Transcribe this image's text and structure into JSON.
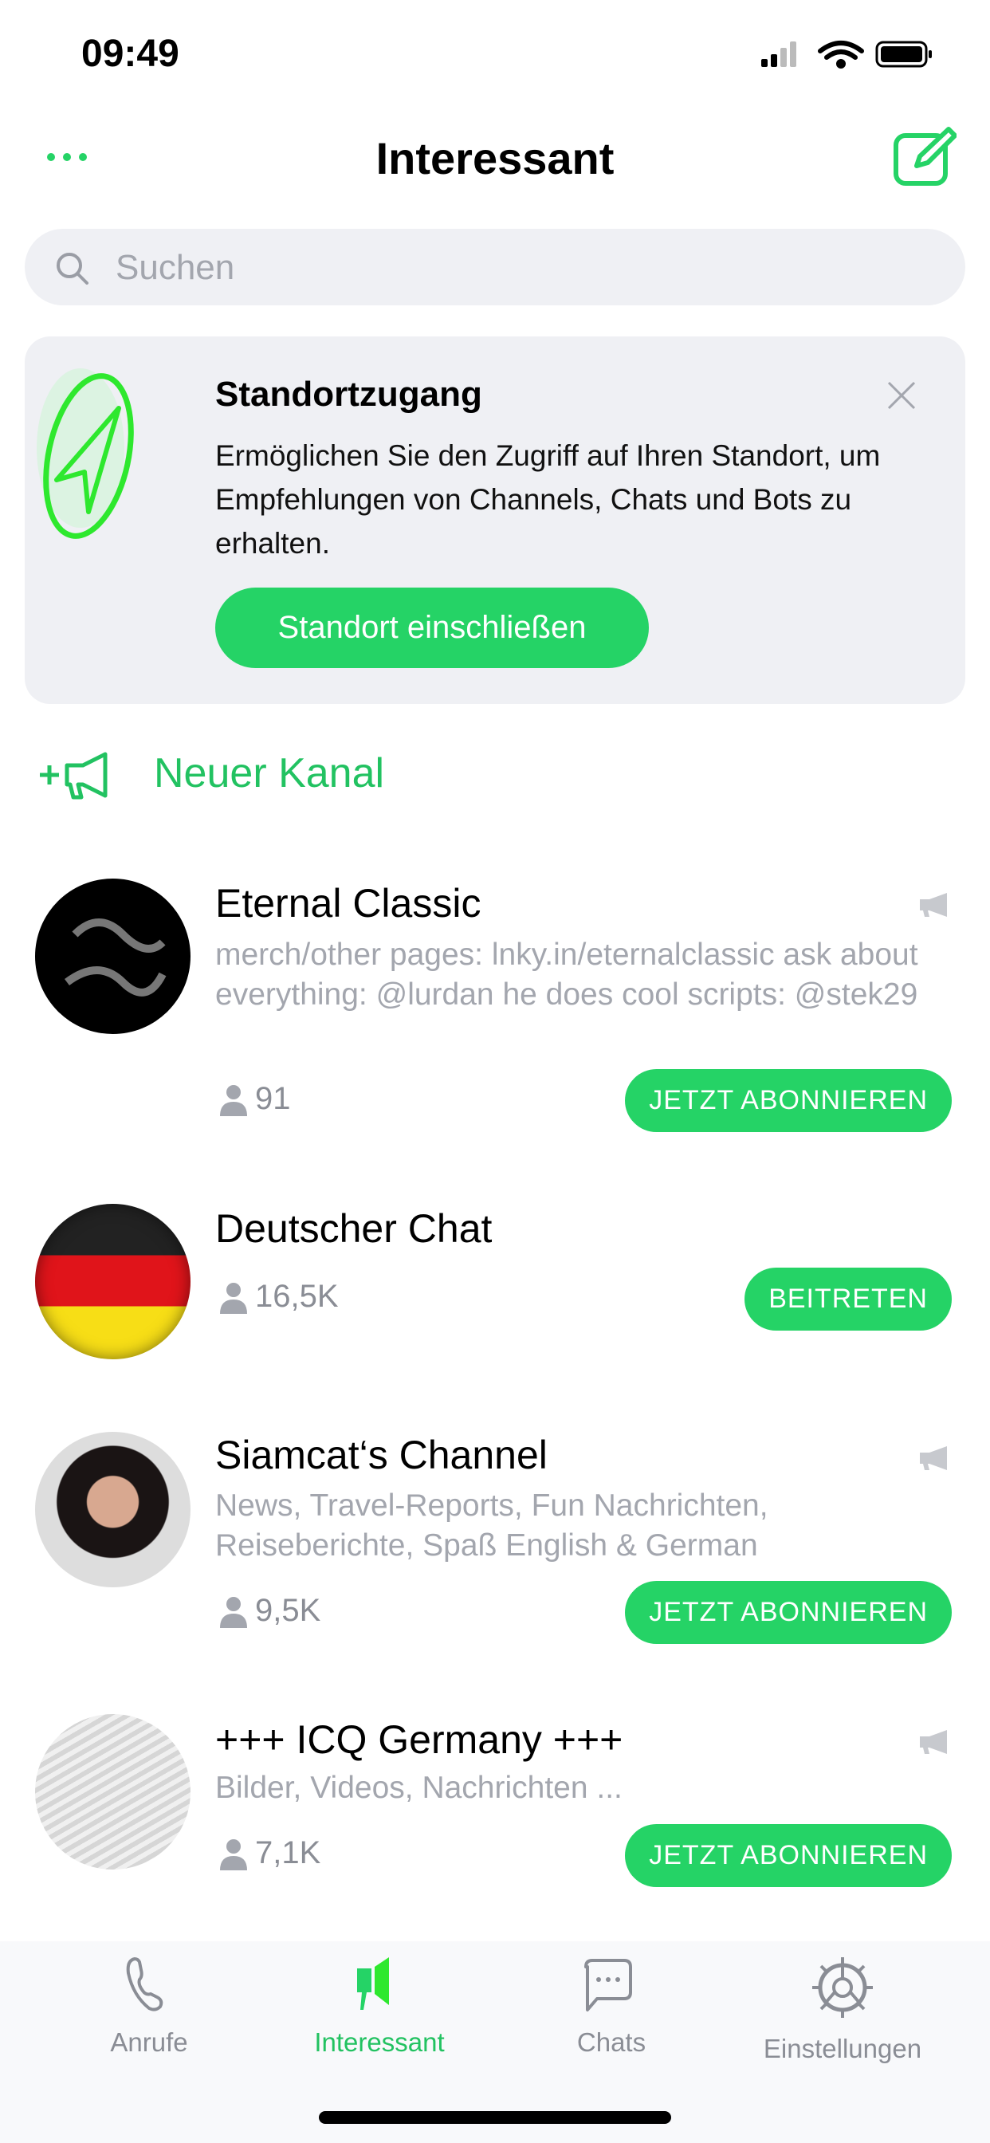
{
  "status_bar": {
    "time": "09:49"
  },
  "header": {
    "title": "Interessant",
    "more_icon": "ellipsis-icon",
    "compose_icon": "compose-icon"
  },
  "search": {
    "placeholder": "Suchen"
  },
  "location_card": {
    "title": "Standortzugang",
    "body": "Ermöglichen Sie den Zugriff auf Ihren Standort, um Empfehlungen von Channels, Chats und Bots zu erhalten.",
    "button": "Standort einschließen"
  },
  "new_channel": {
    "label": "Neuer Kanal"
  },
  "items": [
    {
      "title": "Eternal Classic",
      "desc": "merch/other pages: lnky.in/eternalclassic ask about everything: @lurdan he does cool scripts: @stek29",
      "count": "91",
      "button": "JETZT ABONNIEREN",
      "type": "channel"
    },
    {
      "title": "Deutscher Chat",
      "desc": "",
      "count": "16,5K",
      "button": "BEITRETEN",
      "type": "chat"
    },
    {
      "title": "Siamcat‘s Channel",
      "desc": "News, Travel-Reports, Fun  Nachrichten, Reiseberichte, Spaß   English & German",
      "count": "9,5K",
      "button": "JETZT ABONNIEREN",
      "type": "channel"
    },
    {
      "title": "+++ ICQ Germany +++",
      "desc": "Bilder, Videos, Nachrichten ...",
      "count": "7,1K",
      "button": "JETZT ABONNIEREN",
      "type": "channel"
    }
  ],
  "tabs": [
    {
      "label": "Anrufe"
    },
    {
      "label": "Interessant",
      "active": true
    },
    {
      "label": "Chats"
    },
    {
      "label": "Einstellungen"
    }
  ],
  "colors": {
    "accent": "#25d366",
    "text_secondary": "#a3a6ae",
    "tab_inactive": "#8a8d95"
  }
}
